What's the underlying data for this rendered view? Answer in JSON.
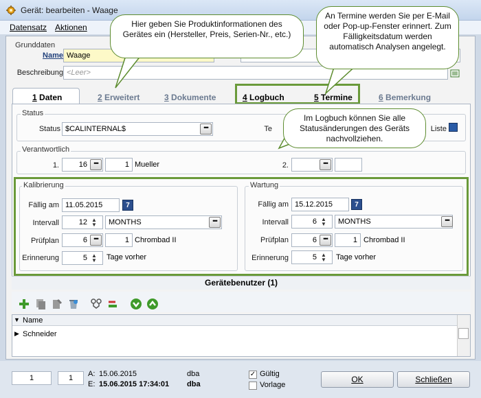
{
  "window": {
    "title": "Gerät: bearbeiten - Waage"
  },
  "menu": {
    "items": [
      "Datensatz",
      "Aktionen"
    ]
  },
  "grunddaten": {
    "group_label": "Grunddaten",
    "name_label": "Name",
    "name_value": "Waage",
    "beschreibung_label": "Beschreibung",
    "beschreibung_placeholder": "<Leer>"
  },
  "tabs": [
    {
      "num": "1",
      "label": "Daten"
    },
    {
      "num": "2",
      "label": "Erweitert"
    },
    {
      "num": "3",
      "label": "Dokumente"
    },
    {
      "num": "4",
      "label": "Logbuch"
    },
    {
      "num": "5",
      "label": "Termine"
    },
    {
      "num": "6",
      "label": "Bemerkung"
    }
  ],
  "status": {
    "group_label": "Status",
    "status_label": "Status",
    "status_value": "$CALINTERNAL$",
    "te_label": "Te",
    "liste_label": "Liste"
  },
  "verantwortlich": {
    "group_label": "Verantwortlich",
    "row1_label": "1.",
    "row1_num": "16",
    "row1_id": "1",
    "row1_name": "Mueller",
    "row2_label": "2."
  },
  "kalibrierung": {
    "group_label": "Kalibrierung",
    "faellig_label": "Fällig am",
    "faellig_value": "11.05.2015",
    "intervall_label": "Intervall",
    "intervall_value": "12",
    "intervall_unit": "MONTHS",
    "pruefplan_label": "Prüfplan",
    "pruefplan_value": "6",
    "pruefplan_id": "1",
    "pruefplan_name": "Chrombad II",
    "erinnerung_label": "Erinnerung",
    "erinnerung_value": "5",
    "erinnerung_suffix": "Tage vorher"
  },
  "wartung": {
    "group_label": "Wartung",
    "faellig_label": "Fällig am",
    "faellig_value": "15.12.2015",
    "intervall_label": "Intervall",
    "intervall_value": "6",
    "intervall_unit": "MONTHS",
    "pruefplan_label": "Prüfplan",
    "pruefplan_value": "6",
    "pruefplan_id": "1",
    "pruefplan_name": "Chrombad II",
    "erinnerung_label": "Erinnerung",
    "erinnerung_value": "5",
    "erinnerung_suffix": "Tage vorher"
  },
  "geraetebenutzer": {
    "header": "Gerätebenutzer (1)",
    "column_name": "Name",
    "rows": [
      "Schneider"
    ]
  },
  "footer": {
    "page_current": "1",
    "page_total": "1",
    "a_label": "A:",
    "a_date": "15.06.2015",
    "a_user": "dba",
    "e_label": "E:",
    "e_date": "15.06.2015 17:34:01",
    "e_user": "dba",
    "gueltig_label": "Gültig",
    "vorlage_label": "Vorlage",
    "ok_label": "OK",
    "schliessen_label": "Schließen"
  },
  "callouts": {
    "grunddaten": "Hier geben Sie Produktinformationen des Gerätes ein (Hersteller, Preis, Serien-Nr., etc.)",
    "termine": "An Termine werden Sie per E-Mail oder Pop-up-Fenster erinnert. Zum Fälligkeitsdatum werden automatisch Analysen angelegt.",
    "logbuch": "Im Logbuch können Sie alle Statusänderungen des Geräts nachvollziehen."
  },
  "colors": {
    "callout_border": "#5d8c2f",
    "highlight_green": "#6a9a3a",
    "name_field_bg": "#fdf9c8"
  }
}
